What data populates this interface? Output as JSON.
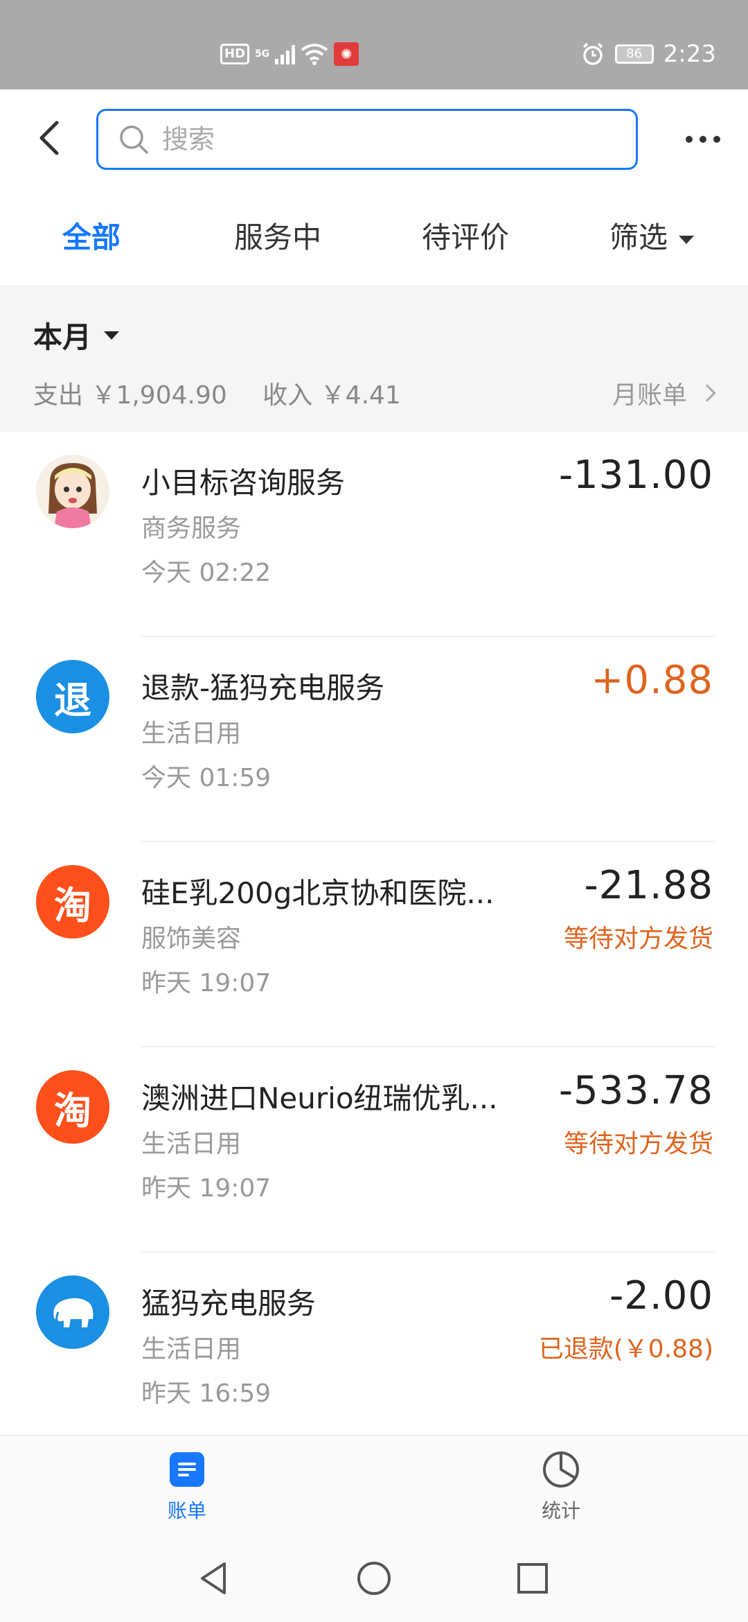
{
  "status_bar": {
    "hd": "HD",
    "network": "5G",
    "battery": "86",
    "time": "2:23",
    "app_icon": "notification-icon"
  },
  "header": {
    "search_placeholder": "搜索"
  },
  "tabs": [
    {
      "label": "全部",
      "active": true
    },
    {
      "label": "服务中",
      "active": false
    },
    {
      "label": "待评价",
      "active": false
    },
    {
      "label": "筛选",
      "active": false
    }
  ],
  "month": {
    "title": "本月",
    "expense": "支出 ￥1,904.90",
    "income": "收入 ￥4.41",
    "monthly_bill": "月账单"
  },
  "transactions": [
    {
      "title": "小目标咨询服务",
      "category": "商务服务",
      "time": "今天  02:22",
      "amount": "-131.00",
      "status": "",
      "avatar": "cartoon-girl",
      "avatar_color": "#f3e6d8"
    },
    {
      "title": "退款-猛犸充电服务",
      "category": "生活日用",
      "time": "今天  01:59",
      "amount": "+0.88",
      "status": "",
      "avatar": "退",
      "avatar_color": "#1a8fe3"
    },
    {
      "title": "硅E乳200g北京协和医院...",
      "category": "服饰美容",
      "time": "昨天  19:07",
      "amount": "-21.88",
      "status": "等待对方发货",
      "avatar": "淘",
      "avatar_color": "#ff4f1a"
    },
    {
      "title": "澳洲进口Neurio纽瑞优乳...",
      "category": "生活日用",
      "time": "昨天  19:07",
      "amount": "-533.78",
      "status": "等待对方发货",
      "avatar": "淘",
      "avatar_color": "#ff4f1a"
    },
    {
      "title": "猛犸充电服务",
      "category": "生活日用",
      "time": "昨天  16:59",
      "amount": "-2.00",
      "status": "已退款(￥0.88)",
      "avatar": "mammoth-icon",
      "avatar_color": "#1a8fe3"
    }
  ],
  "bottom_nav": [
    {
      "label": "账单",
      "icon": "bill-icon",
      "active": true
    },
    {
      "label": "统计",
      "icon": "pie-chart-icon",
      "active": false
    }
  ],
  "colors": {
    "accent": "#1677ff",
    "orange": "#e0631e",
    "alipay_blue": "#1a8fe3",
    "taobao": "#ff4f1a"
  }
}
